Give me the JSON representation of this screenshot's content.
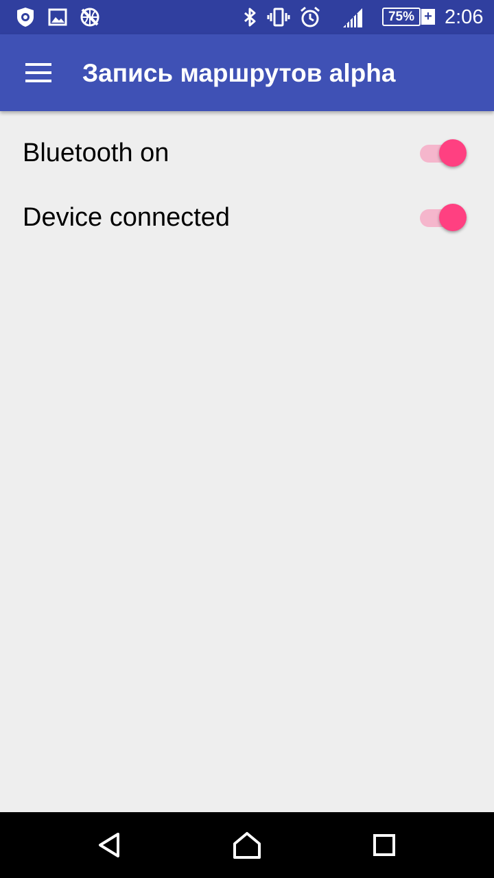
{
  "status_bar": {
    "icons": [
      "shield-app-icon",
      "image-icon",
      "no-network-icon",
      "bluetooth-icon",
      "vibrate-icon",
      "alarm-icon",
      "signal-icon",
      "battery-icon"
    ],
    "battery_percent": "75%",
    "battery_plus": "+",
    "time": "2:06"
  },
  "app_bar": {
    "menu_icon": "hamburger-menu-icon",
    "title": "Запись маршрутов alpha"
  },
  "settings": [
    {
      "label": "Bluetooth on",
      "enabled": true
    },
    {
      "label": "Device connected",
      "enabled": true
    }
  ],
  "colors": {
    "status_bar": "#303f9f",
    "app_bar": "#3f51b5",
    "accent": "#ff4081",
    "switch_track": "#f5b6cc",
    "background": "#eeeeee"
  },
  "nav_bar": {
    "icons": [
      "back-icon",
      "home-icon",
      "recents-icon"
    ]
  }
}
